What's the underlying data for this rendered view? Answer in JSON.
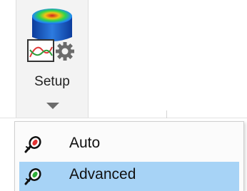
{
  "ribbon": {
    "setup_button": {
      "label": "Setup",
      "icon": "setup-icon"
    }
  },
  "menu": {
    "items": [
      {
        "label": "Auto",
        "icon": "sensor-probe-icon",
        "selected": false
      },
      {
        "label": "Advanced",
        "icon": "sensor-probe-icon",
        "selected": true
      }
    ]
  },
  "colors": {
    "highlight": "#a7d3f6",
    "ribbon_bg": "#f3f3f3"
  }
}
